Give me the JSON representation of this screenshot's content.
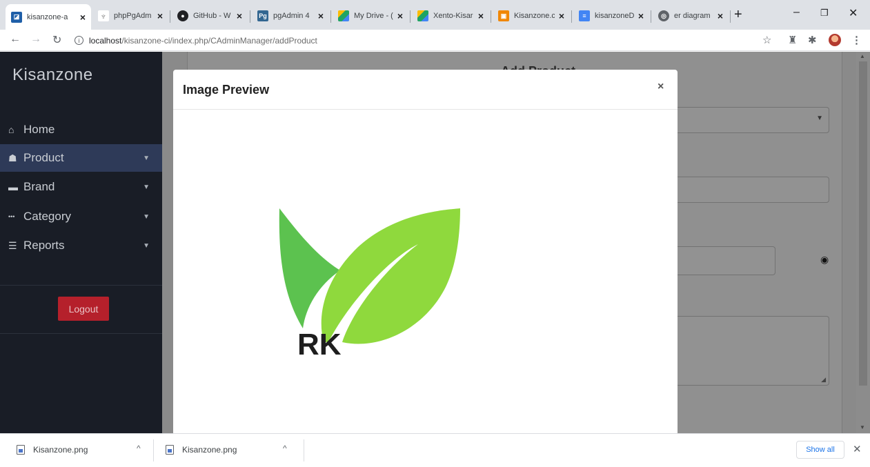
{
  "browser": {
    "tabs": [
      {
        "title": "kisanzone-a",
        "icon": "kisanzone-favicon",
        "color": "#1f5fa8",
        "active": true
      },
      {
        "title": "phpPgAdm",
        "icon": "phppgadmin-favicon",
        "color": "#7a7a7a"
      },
      {
        "title": "GitHub - W",
        "icon": "github-favicon",
        "color": "#202124"
      },
      {
        "title": "pgAdmin 4",
        "icon": "pgadmin-favicon",
        "color": "#336791"
      },
      {
        "title": "My Drive - (",
        "icon": "google-drive-favicon",
        "color": "#1fa463"
      },
      {
        "title": "Xento-Kisar",
        "icon": "google-drive-favicon",
        "color": "#1fa463"
      },
      {
        "title": "Kisanzone.c",
        "icon": "drawio-favicon",
        "color": "#f08705"
      },
      {
        "title": "kisanzoneD",
        "icon": "google-docs-favicon",
        "color": "#4285f4"
      },
      {
        "title": "er diagram",
        "icon": "web-favicon",
        "color": "#5f6368"
      }
    ],
    "url_host": "localhost",
    "url_path": "/kisanzone-ci/index.php/CAdminManager/addProduct"
  },
  "sidebar": {
    "brand": "Kisanzone",
    "items": [
      {
        "label": "Home",
        "icon": "home-icon",
        "glyph": "⌂",
        "has_caret": false
      },
      {
        "label": "Product",
        "icon": "sitemap-icon",
        "glyph": "☗",
        "has_caret": true,
        "active": true
      },
      {
        "label": "Brand",
        "icon": "briefcase-icon",
        "glyph": "▬",
        "has_caret": true
      },
      {
        "label": "Category",
        "icon": "ellipsis-icon",
        "glyph": "•••",
        "has_caret": true
      },
      {
        "label": "Reports",
        "icon": "list-icon",
        "glyph": "☰",
        "has_caret": true
      }
    ],
    "logout_label": "Logout"
  },
  "form": {
    "title": "Add Product"
  },
  "modal": {
    "title": "Image Preview",
    "close_glyph": "×",
    "image_text": "RK",
    "leaf_colors": [
      "#5cc24f",
      "#8fd93d"
    ]
  },
  "downloads": {
    "items": [
      {
        "filename": "Kisanzone.png"
      },
      {
        "filename": "Kisanzone.png"
      }
    ],
    "show_all_label": "Show all"
  },
  "colors": {
    "sidebar_bg": "#191d26",
    "sidebar_active": "#2e3a58",
    "logout_bg": "#b5202b",
    "overlay": "#7e7e7e"
  }
}
